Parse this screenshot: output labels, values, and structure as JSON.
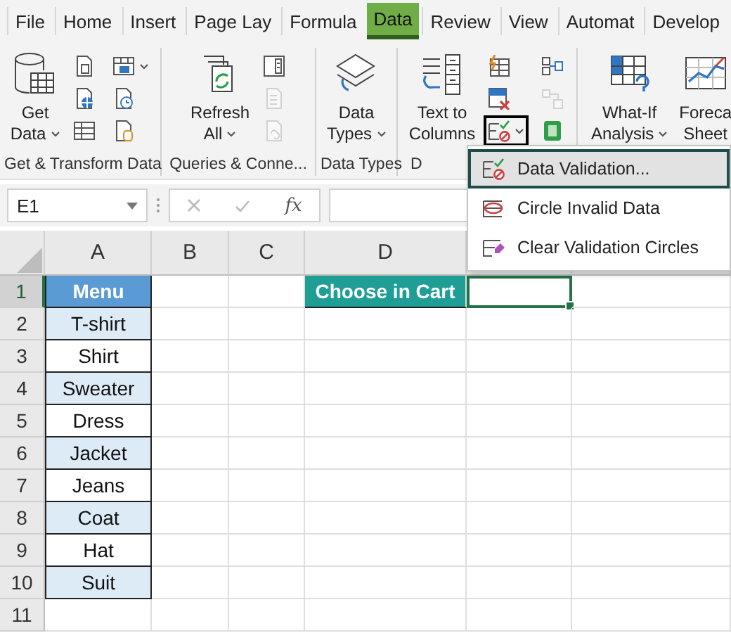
{
  "tabs": [
    {
      "label": "File",
      "selected": false
    },
    {
      "label": "Home",
      "selected": false
    },
    {
      "label": "Insert",
      "selected": false
    },
    {
      "label": "Page Lay",
      "selected": false
    },
    {
      "label": "Formula",
      "selected": false
    },
    {
      "label": "Data",
      "selected": true
    },
    {
      "label": "Review",
      "selected": false
    },
    {
      "label": "View",
      "selected": false
    },
    {
      "label": "Automat",
      "selected": false
    },
    {
      "label": "Develop",
      "selected": false
    }
  ],
  "ribbon": {
    "groups": [
      {
        "label": "Get & Transform Data",
        "large": [
          {
            "label": "Get\nData",
            "kind": "database",
            "menu": true
          }
        ],
        "small": [
          {
            "kind": "doc-table",
            "menu": false,
            "disabled": false,
            "pressed": false
          },
          {
            "kind": "doc-web",
            "menu": false,
            "disabled": false,
            "pressed": false
          },
          {
            "kind": "table",
            "menu": false,
            "disabled": false,
            "pressed": false
          },
          {
            "kind": "table-picture",
            "menu": true,
            "disabled": false,
            "pressed": false
          },
          {
            "kind": "doc-clock",
            "menu": false,
            "disabled": false,
            "pressed": false
          },
          {
            "kind": "doc-db",
            "menu": false,
            "disabled": false,
            "pressed": false
          }
        ]
      },
      {
        "label": "Queries & Conne...",
        "large": [
          {
            "label": "Refresh\nAll",
            "kind": "refresh",
            "menu": true
          }
        ],
        "small": [
          {
            "kind": "panel",
            "menu": false,
            "disabled": false,
            "pressed": false
          },
          {
            "kind": "doc-list",
            "menu": false,
            "disabled": true,
            "pressed": false
          },
          {
            "kind": "doc-link",
            "menu": false,
            "disabled": true,
            "pressed": false
          }
        ]
      },
      {
        "label": "Data Types",
        "large": [
          {
            "label": "Data\nTypes",
            "kind": "layers",
            "menu": true
          }
        ]
      },
      {
        "label": "D",
        "large": [
          {
            "label": "Text to\nColumns",
            "kind": "columns",
            "menu": false
          }
        ],
        "small": [
          {
            "kind": "flash-fill",
            "menu": false,
            "disabled": false,
            "pressed": false
          },
          {
            "kind": "remove-dup",
            "menu": false,
            "disabled": false,
            "pressed": false
          },
          {
            "kind": "validation",
            "menu": true,
            "disabled": false,
            "pressed": true
          },
          {
            "kind": "consolidate",
            "menu": false,
            "disabled": false,
            "pressed": false
          },
          {
            "kind": "relationships",
            "menu": false,
            "disabled": true,
            "pressed": false
          },
          {
            "kind": "data-model",
            "menu": false,
            "disabled": false,
            "pressed": false
          }
        ]
      },
      {
        "large": [
          {
            "label": "What-If\nAnalysis",
            "kind": "what-if",
            "menu": true
          },
          {
            "label": "Foreca\nSheet",
            "kind": "forecast",
            "menu": false
          }
        ]
      }
    ]
  },
  "formula_bar": {
    "name_box": "E1",
    "function_label": "fx"
  },
  "sheet": {
    "columns": [
      "A",
      "B",
      "C",
      "D"
    ],
    "rows": [
      {
        "header": "1",
        "selected": true,
        "cells": [
          {
            "text": "Menu",
            "kind": "header",
            "selected": false
          },
          {
            "kind": "blank",
            "selected": false
          },
          {
            "kind": "blank",
            "selected": false
          },
          {
            "text": "Choose in Cart",
            "kind": "accent",
            "selected": false
          },
          {
            "kind": "blank",
            "selected": true
          }
        ]
      },
      {
        "header": "2",
        "selected": false,
        "cells": [
          {
            "text": "T-shirt",
            "kind": "band",
            "selected": false
          }
        ]
      },
      {
        "header": "3",
        "selected": false,
        "cells": [
          {
            "text": "Shirt",
            "kind": "plain",
            "selected": false
          }
        ]
      },
      {
        "header": "4",
        "selected": false,
        "cells": [
          {
            "text": "Sweater",
            "kind": "band",
            "selected": false
          }
        ]
      },
      {
        "header": "5",
        "selected": false,
        "cells": [
          {
            "text": "Dress",
            "kind": "plain",
            "selected": false
          }
        ]
      },
      {
        "header": "6",
        "selected": false,
        "cells": [
          {
            "text": "Jacket",
            "kind": "band",
            "selected": false
          }
        ]
      },
      {
        "header": "7",
        "selected": false,
        "cells": [
          {
            "text": "Jeans",
            "kind": "plain",
            "selected": false
          }
        ]
      },
      {
        "header": "8",
        "selected": false,
        "cells": [
          {
            "text": "Coat",
            "kind": "band",
            "selected": false
          }
        ]
      },
      {
        "header": "9",
        "selected": false,
        "cells": [
          {
            "text": "Hat",
            "kind": "plain",
            "selected": false
          }
        ]
      },
      {
        "header": "10",
        "selected": false,
        "cells": [
          {
            "text": "Suit",
            "kind": "band",
            "selected": false
          }
        ]
      },
      {
        "header": "11",
        "selected": false
      }
    ]
  },
  "dropdown_menu": {
    "items": [
      {
        "label": "Data Validation...",
        "kind": "validation",
        "selected": true
      },
      {
        "label": "Circle Invalid Data",
        "kind": "circle",
        "selected": false
      },
      {
        "label": "Clear Validation Circles",
        "kind": "eraser",
        "selected": false
      }
    ]
  }
}
